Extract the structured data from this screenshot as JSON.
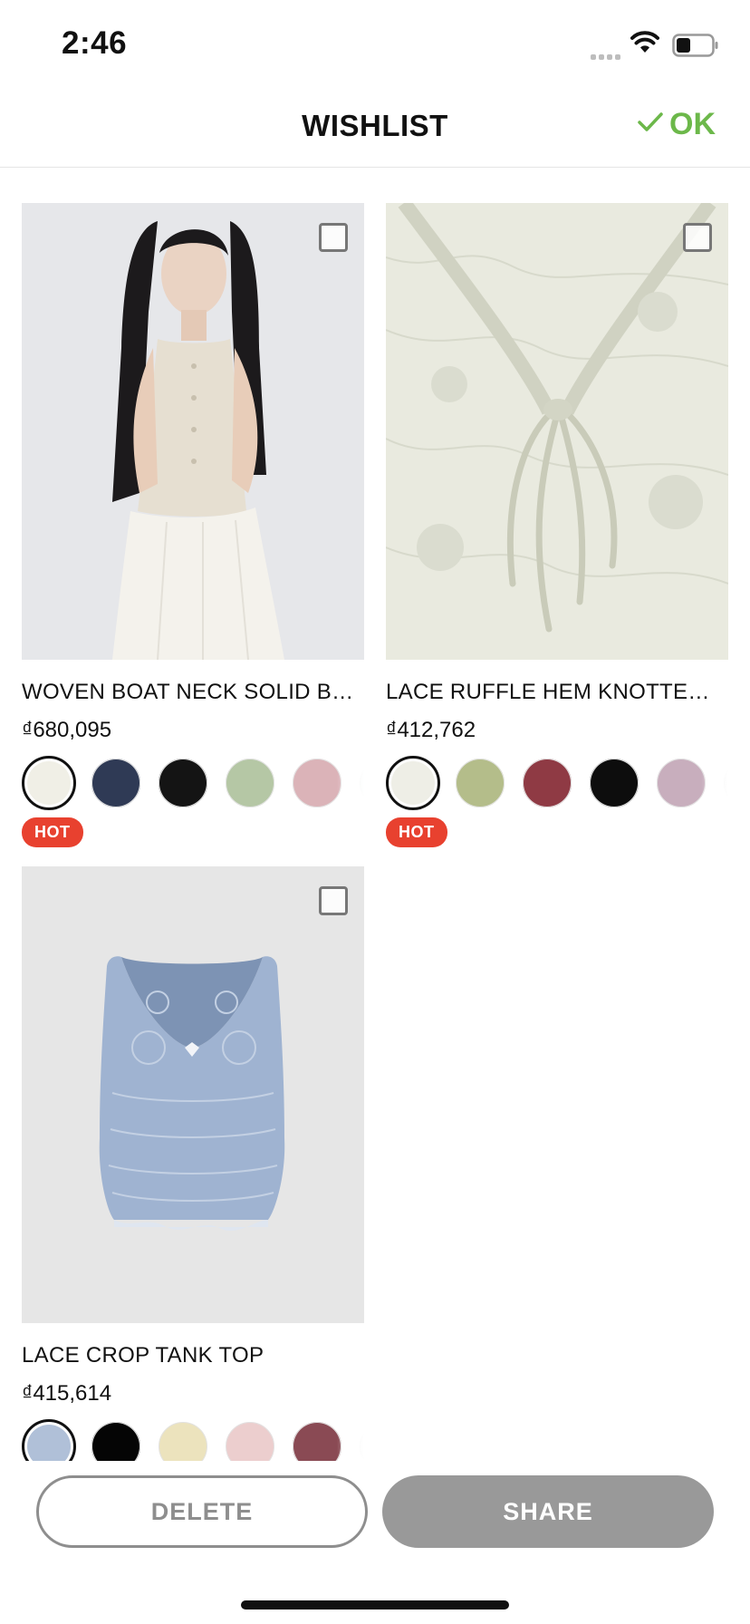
{
  "status_bar": {
    "time": "2:46"
  },
  "header": {
    "title": "WISHLIST",
    "ok_label": "OK"
  },
  "products": [
    {
      "name": "WOVEN BOAT NECK SOLID BU...",
      "price": "₫680,095",
      "badge": "HOT",
      "image": "model-sleeveless-button-vest-icon",
      "swatches": [
        "#f0efe6",
        "#2f3a55",
        "#141414",
        "#b5c7a5",
        "#dbb3b8",
        "#e8f2ee"
      ],
      "selected_swatch": 0
    },
    {
      "name": "LACE RUFFLE HEM KNOTTED...",
      "price": "₫412,762",
      "badge": "HOT",
      "image": "lace-knotted-top-closeup-icon",
      "swatches": [
        "#eeeee6",
        "#b4bd8a",
        "#8f3a44",
        "#0d0d0d",
        "#c8aebd",
        "#ececec"
      ],
      "selected_swatch": 0
    },
    {
      "name": "LACE CROP TANK TOP",
      "price": "₫415,614",
      "badge": "",
      "image": "lace-crop-tank-top-icon",
      "swatches": [
        "#b0c0d8",
        "#050505",
        "#ece3bd",
        "#eccece",
        "#8a4a54",
        "#f4f4f4"
      ],
      "selected_swatch": 0
    }
  ],
  "actions": {
    "delete_label": "DELETE",
    "share_label": "SHARE"
  }
}
